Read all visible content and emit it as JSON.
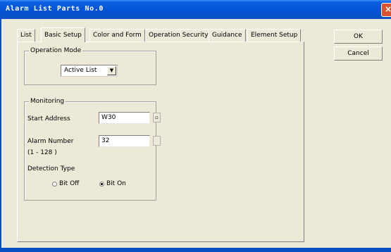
{
  "window": {
    "title": "Alarm List Parts No.0",
    "close_glyph": "×"
  },
  "tabs": [
    {
      "label": "List"
    },
    {
      "label": "Basic Setup"
    },
    {
      "label": "Color and Form"
    },
    {
      "label": "Operation Security"
    },
    {
      "label": "Guidance"
    },
    {
      "label": "Element Setup"
    }
  ],
  "active_tab": "Basic Setup",
  "operation_mode": {
    "group_label": "Operation Mode",
    "selected": "Active List",
    "arrow_glyph": "▼"
  },
  "monitoring": {
    "group_label": "Monitoring",
    "start_address": {
      "label": "Start Address",
      "value": "W30"
    },
    "alarm_number": {
      "label": "Alarm Number",
      "range": "(1 - 128 )",
      "value": "32"
    },
    "detection_type": {
      "label": "Detection Type",
      "options": [
        {
          "label": "Bit Off",
          "checked": false
        },
        {
          "label": "Bit On",
          "checked": true
        }
      ]
    }
  },
  "buttons": {
    "ok": "OK",
    "cancel": "Cancel"
  }
}
